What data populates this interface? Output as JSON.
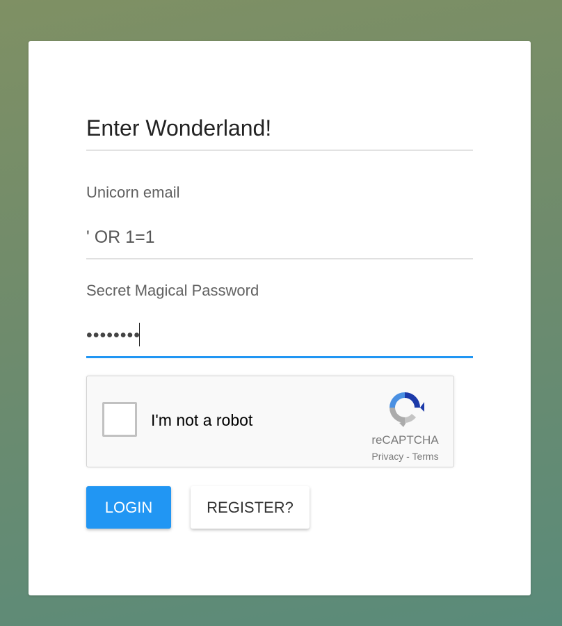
{
  "form": {
    "title": "Enter Wonderland!",
    "email_label": "Unicorn email",
    "email_value": "' OR 1=1",
    "password_label": "Secret Magical Password",
    "password_value": "••••••••"
  },
  "recaptcha": {
    "checkbox_label": "I'm not a robot",
    "brand": "reCAPTCHA",
    "privacy": "Privacy",
    "separator": " - ",
    "terms": "Terms",
    "logo_icon": "recaptcha-logo-icon"
  },
  "buttons": {
    "login": "LOGIN",
    "register": "REGISTER?"
  },
  "colors": {
    "accent": "#2196f3",
    "background_top": "#7f9064",
    "background_bottom": "#5a8b7a"
  }
}
